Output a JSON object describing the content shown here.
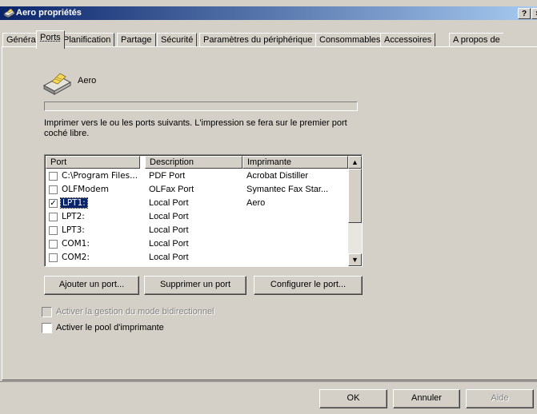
{
  "window": {
    "title": "Aero propriétés",
    "help_btn": "?",
    "close_btn": "×"
  },
  "tabs": [
    {
      "label": "Général"
    },
    {
      "label": "Ports"
    },
    {
      "label": "Planification"
    },
    {
      "label": "Partage"
    },
    {
      "label": "Sécurité"
    },
    {
      "label": "Paramètres du périphérique"
    },
    {
      "label": "Consommables"
    },
    {
      "label": "Accessoires"
    },
    {
      "label": "A propos de"
    }
  ],
  "printer": {
    "name": "Aero",
    "icon": "printer-icon"
  },
  "instructions": "Imprimer vers le ou les ports suivants. L'impression se fera sur le premier port coché libre.",
  "ports_table": {
    "headers": {
      "port": "Port",
      "description": "Description",
      "printer": "Imprimante"
    },
    "rows": [
      {
        "port": "C:\\Program Files...",
        "description": "PDF Port",
        "printer": "Acrobat Distiller",
        "checked": false
      },
      {
        "port": "OLFModem",
        "description": "OLFax Port",
        "printer": "Symantec Fax Star...",
        "checked": false
      },
      {
        "port": "LPT1:",
        "description": "Local Port",
        "printer": "Aero",
        "checked": true
      },
      {
        "port": "LPT2:",
        "description": "Local Port",
        "printer": "",
        "checked": false
      },
      {
        "port": "LPT3:",
        "description": "Local Port",
        "printer": "",
        "checked": false
      },
      {
        "port": "COM1:",
        "description": "Local Port",
        "printer": "",
        "checked": false
      },
      {
        "port": "COM2:",
        "description": "Local Port",
        "printer": "",
        "checked": false
      }
    ]
  },
  "buttons": {
    "add_port": "Ajouter un port...",
    "delete_port": "Supprimer un port",
    "configure_port": "Configurer le port...",
    "ok": "OK",
    "cancel": "Annuler",
    "help": "Aide"
  },
  "options": {
    "bidirectional": "Activer la gestion du mode bidirectionnel",
    "pool": "Activer le pool d'imprimante"
  },
  "colors": {
    "face": "#d4d0c8",
    "title_start": "#0a246a",
    "title_end": "#a6caf0",
    "selection": "#0a246a"
  }
}
